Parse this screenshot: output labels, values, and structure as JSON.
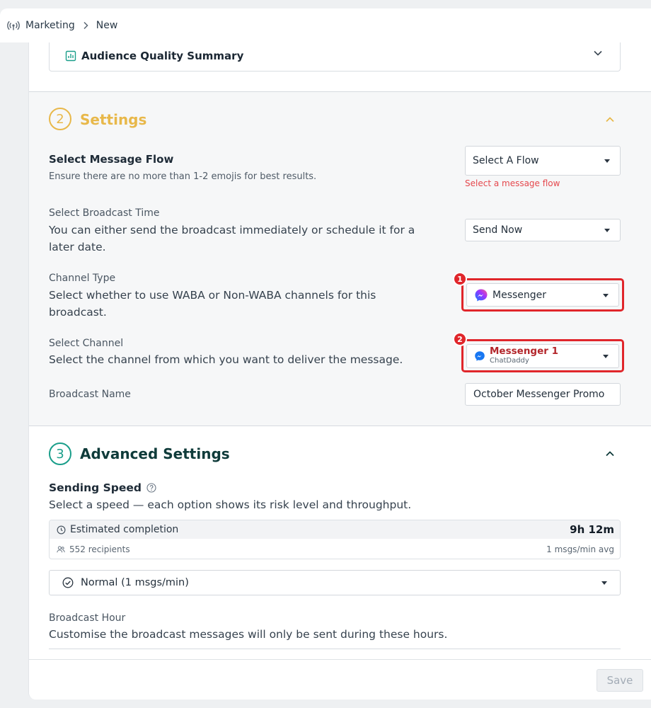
{
  "breadcrumb": {
    "root": "Marketing",
    "current": "New"
  },
  "audience_card": {
    "title": "Audience Quality Summary"
  },
  "settings": {
    "step": "2",
    "title": "Settings",
    "message_flow": {
      "label": "Select Message Flow",
      "hint": "Ensure there are no more than 1-2 emojis for best results.",
      "value": "Select A Flow",
      "error": "Select a message flow"
    },
    "broadcast_time": {
      "label": "Select Broadcast Time",
      "desc_line1": "You can either send the broadcast immediately or schedule it for a",
      "desc_line2": "later date.",
      "value": "Send Now"
    },
    "channel_type": {
      "label": "Channel Type",
      "desc_line1": "Select whether to use WABA or Non-WABA channels for this",
      "desc_line2": "broadcast.",
      "value": "Messenger",
      "badge": "1"
    },
    "channel": {
      "label": "Select Channel",
      "desc": "Select the channel from which you want to deliver the message.",
      "value": "Messenger 1",
      "sub": "ChatDaddy",
      "badge": "2"
    },
    "broadcast_name": {
      "label": "Broadcast Name",
      "value": "October Messenger Promo"
    }
  },
  "advanced": {
    "step": "3",
    "title": "Advanced Settings",
    "sending_speed": {
      "label": "Sending Speed",
      "desc": "Select a speed — each option shows its risk level and throughput.",
      "est_label": "Estimated completion",
      "est_value": "9h 12m",
      "recipients": "552 recipients",
      "avg": "1 msgs/min avg",
      "option": "Normal (1 msgs/min)"
    },
    "broadcast_hour": {
      "label": "Broadcast Hour",
      "desc": "Customise the broadcast messages will only be sent during these hours."
    }
  },
  "footer": {
    "save": "Save"
  },
  "colors": {
    "settings_accent": "#e8b84a",
    "advanced_accent": "#1a9e8a",
    "error": "#e5484d",
    "highlight": "#e0262b"
  }
}
